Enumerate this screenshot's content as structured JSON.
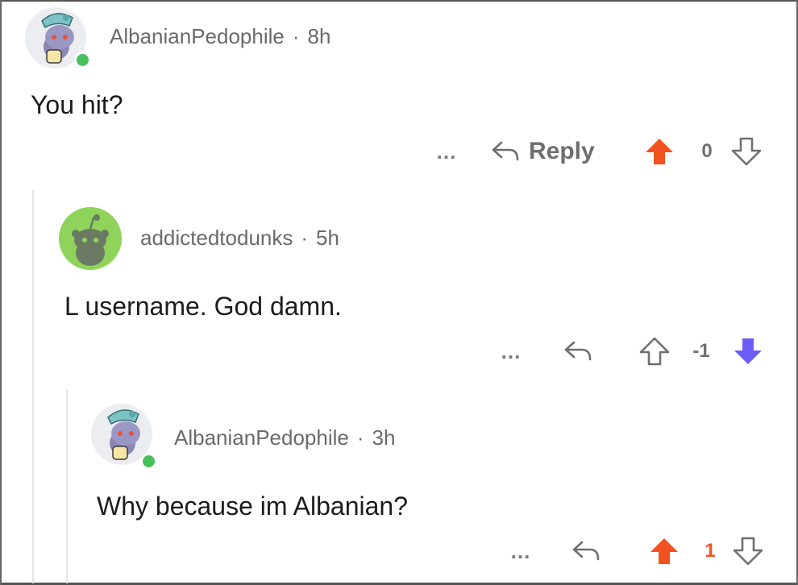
{
  "comments": [
    {
      "username": "AlbanianPedophile",
      "age": "8h",
      "text": "You hit?",
      "more": "...",
      "reply_label": "Reply",
      "score": "0",
      "vote_state": "up"
    },
    {
      "username": "addictedtodunks",
      "age": "5h",
      "text": "L username.  God damn.",
      "more": "...",
      "score": "-1",
      "vote_state": "down"
    },
    {
      "username": "AlbanianPedophile",
      "age": "3h",
      "text": "Why because im Albanian?",
      "more": "...",
      "score": "1",
      "vote_state": "up"
    }
  ],
  "separator": "·",
  "icons": {
    "reply": "reply-arrow-icon",
    "upvote": "upvote-arrow-icon",
    "downvote": "downvote-arrow-icon"
  },
  "colors": {
    "upvote": "#f2521f",
    "downvote": "#6b5cf6",
    "muted": "#6a6a6d",
    "online": "#46c05a",
    "avatar_green": "#8fd35a"
  }
}
